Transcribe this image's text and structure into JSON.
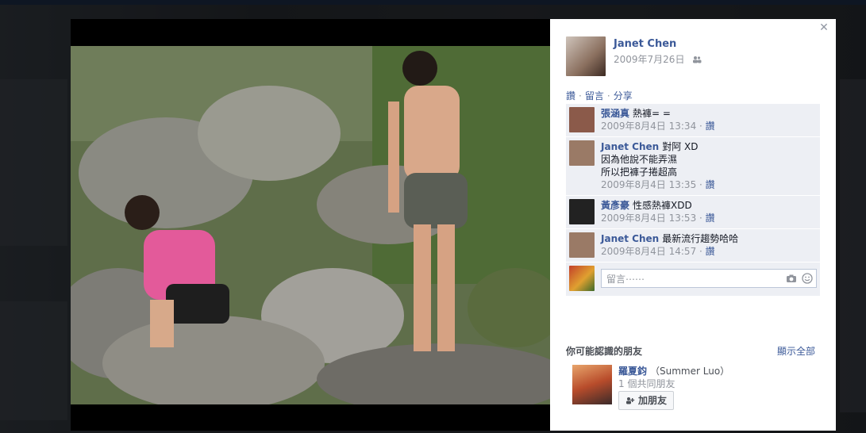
{
  "owner": {
    "name": "Janet Chen",
    "date": "2009年7月26日"
  },
  "actions": [
    "讚",
    "留言",
    "分享"
  ],
  "comments": [
    {
      "author": "張涵真",
      "text": "熱褲= =",
      "lines": [],
      "time": "2009年8月4日 13:34",
      "like": "讚",
      "avatar_color": "#8b5a4a"
    },
    {
      "author": "Janet Chen",
      "text": "對阿 XD",
      "lines": [
        "因為他說不能弄濕",
        "所以把褲子捲超高"
      ],
      "time": "2009年8月4日 13:35",
      "like": "讚",
      "avatar_color": "#9a7a66"
    },
    {
      "author": "黃彥豪",
      "text": "性感熱褲XDD",
      "lines": [],
      "time": "2009年8月4日 13:53",
      "like": "讚",
      "avatar_color": "#222222"
    },
    {
      "author": "Janet Chen",
      "text": "最新流行趨勢哈哈",
      "lines": [],
      "time": "2009年8月4日 14:57",
      "like": "讚",
      "avatar_color": "#9a7a66"
    }
  ],
  "compose": {
    "placeholder": "留言⋯⋯"
  },
  "pymk": {
    "title": "你可能認識的朋友",
    "see_all": "顯示全部",
    "person": {
      "name": "羅夏鈞",
      "alt_name": "（Summer Luo）",
      "mutual": "1 個共同朋友",
      "add_label": "加朋友"
    }
  },
  "colors": {
    "link": "#3b5998",
    "meta": "#90949c",
    "comment_bg": "#edeff4"
  }
}
